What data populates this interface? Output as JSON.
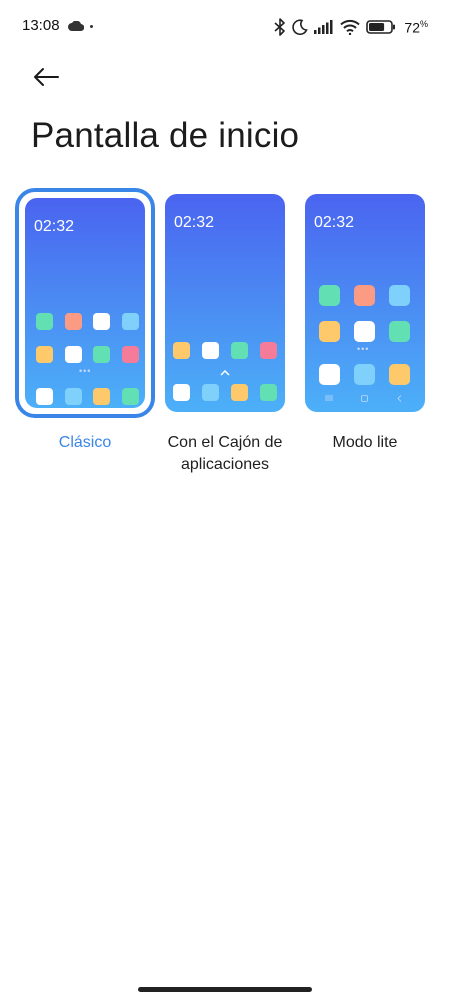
{
  "status_bar": {
    "time": "13:08",
    "battery_percent": "72",
    "battery_level": 0.72
  },
  "header": {
    "title": "Pantalla de inicio"
  },
  "options": [
    {
      "label": "Clásico",
      "preview_time": "02:32",
      "selected": true
    },
    {
      "label": "Con el Cajón de aplicaciones",
      "preview_time": "02:32",
      "selected": false
    },
    {
      "label": "Modo lite",
      "preview_time": "02:32",
      "selected": false
    }
  ],
  "colors": {
    "accent": "#3a86e8",
    "icon_green": "#62e0b4",
    "icon_orange": "#fb9b84",
    "icon_white": "#ffffff",
    "icon_lightblue": "#7fd1fb",
    "icon_yellow": "#fdc96a",
    "icon_pink": "#f47c98"
  }
}
